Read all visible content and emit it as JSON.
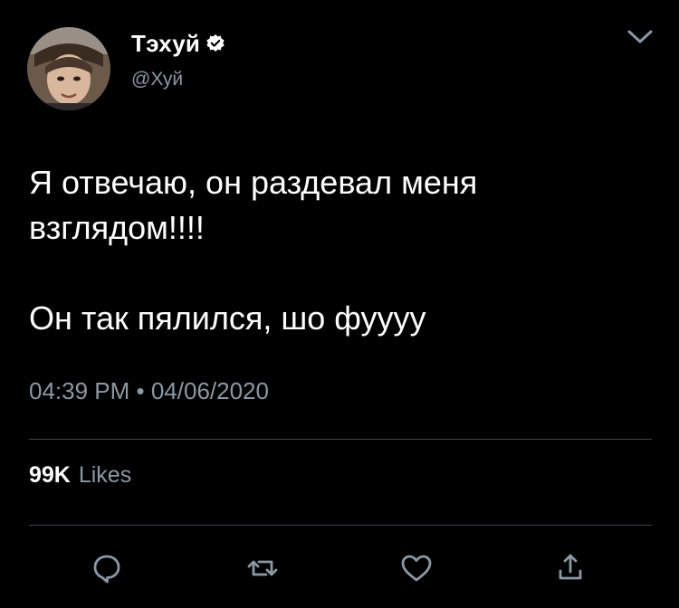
{
  "tweet": {
    "display_name": "Тэхуй",
    "handle": "@Хуй",
    "verified": true,
    "text": "Я отвечаю, он раздевал меня взглядом!!!!\n\nОн так пялился, шо фуууу",
    "timestamp": "04:39 PM • 04/06/2020",
    "likes_count": "99K",
    "likes_label": "Likes"
  },
  "icons": {
    "verified": "verified-badge-icon",
    "menu": "chevron-down-icon",
    "reply": "reply-icon",
    "retweet": "retweet-icon",
    "like": "heart-icon",
    "share": "share-icon"
  },
  "colors": {
    "background": "#000000",
    "text_primary": "#ffffff",
    "text_secondary": "#8b98a5",
    "divider": "#3d4246"
  }
}
